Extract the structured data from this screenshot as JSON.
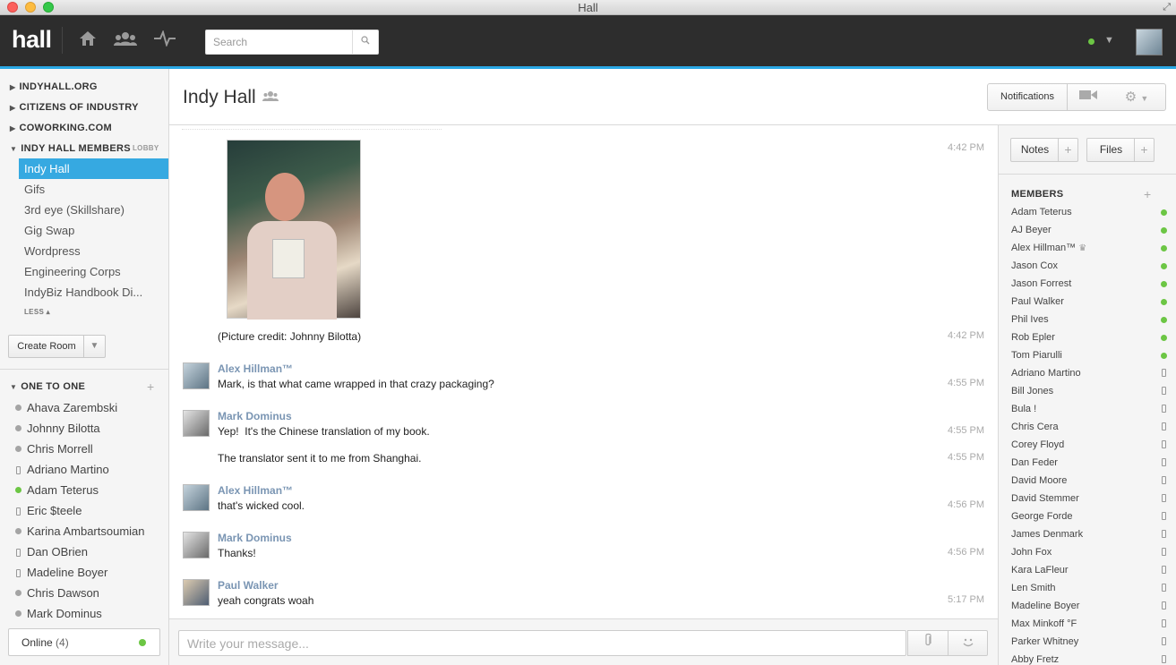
{
  "window": {
    "title": "Hall"
  },
  "topbar": {
    "logo": "hall",
    "search_placeholder": "Search",
    "icons": [
      "home-icon",
      "people-icon",
      "activity-icon",
      "search-icon"
    ]
  },
  "sidebar": {
    "groups": [
      {
        "label": "INDYHALL.ORG"
      },
      {
        "label": "CITIZENS OF INDUSTRY"
      },
      {
        "label": "COWORKING.COM"
      },
      {
        "label": "INDY HALL MEMBERS",
        "tag": "LOBBY"
      }
    ],
    "rooms": [
      {
        "label": "Indy Hall"
      },
      {
        "label": "Gifs"
      },
      {
        "label": "3rd eye (Skillshare)"
      },
      {
        "label": "Gig Swap"
      },
      {
        "label": "Wordpress"
      },
      {
        "label": "Engineering Corps"
      },
      {
        "label": "IndyBiz Handbook Di..."
      }
    ],
    "less_label": "LESS",
    "create_room_label": "Create Room",
    "one_to_one_label": "ONE TO ONE",
    "people": [
      {
        "name": "Ahava Zarembski",
        "status": "offline"
      },
      {
        "name": "Johnny Bilotta",
        "status": "offline"
      },
      {
        "name": "Chris Morrell",
        "status": "offline"
      },
      {
        "name": "Adriano Martino",
        "status": "mobile"
      },
      {
        "name": "Adam Teterus",
        "status": "online"
      },
      {
        "name": "Eric $teele",
        "status": "mobile"
      },
      {
        "name": "Karina Ambartsoumian",
        "status": "offline"
      },
      {
        "name": "Dan OBrien",
        "status": "mobile"
      },
      {
        "name": "Madeline Boyer",
        "status": "mobile"
      },
      {
        "name": "Chris Dawson",
        "status": "offline"
      },
      {
        "name": "Mark Dominus",
        "status": "offline"
      }
    ],
    "online_label": "Online",
    "online_count": "(4)"
  },
  "header": {
    "room_title": "Indy Hall",
    "notifications_label": "Notifications"
  },
  "messages": [
    {
      "text": "",
      "time": "4:42 PM"
    },
    {
      "text": "(Picture credit: Johnny Bilotta)",
      "time": "4:42 PM"
    },
    {
      "author": "Alex Hillman™",
      "text": "Mark, is that what came wrapped in that crazy packaging?",
      "time": "4:55 PM"
    },
    {
      "author": "Mark Dominus",
      "text": "Yep!  It's the Chinese translation of my book.",
      "time": "4:55 PM"
    },
    {
      "text": "The translator sent it to me from Shanghai.",
      "time": "4:55 PM"
    },
    {
      "author": "Alex Hillman™",
      "text": "that's wicked cool.",
      "time": "4:56 PM"
    },
    {
      "author": "Mark Dominus",
      "text": "Thanks!",
      "time": "4:56 PM"
    },
    {
      "author": "Paul Walker",
      "text": "yeah congrats woah",
      "time": "5:17 PM"
    }
  ],
  "composer": {
    "placeholder": "Write your message..."
  },
  "right_panel": {
    "notes_label": "Notes",
    "files_label": "Files",
    "members_label": "MEMBERS",
    "members": [
      {
        "name": "Adam Teterus",
        "status": "online"
      },
      {
        "name": "AJ Beyer",
        "status": "online"
      },
      {
        "name": "Alex Hillman™",
        "status": "online",
        "crown": "♛"
      },
      {
        "name": "Jason Cox",
        "status": "online"
      },
      {
        "name": "Jason Forrest",
        "status": "online"
      },
      {
        "name": "Paul Walker",
        "status": "online"
      },
      {
        "name": "Phil Ives",
        "status": "online"
      },
      {
        "name": "Rob Epler",
        "status": "online"
      },
      {
        "name": "Tom Piarulli",
        "status": "online"
      },
      {
        "name": "Adriano Martino",
        "status": "mobile"
      },
      {
        "name": "Bill Jones",
        "status": "mobile"
      },
      {
        "name": "Bula !",
        "status": "mobile"
      },
      {
        "name": "Chris Cera",
        "status": "mobile"
      },
      {
        "name": "Corey Floyd",
        "status": "mobile"
      },
      {
        "name": "Dan Feder",
        "status": "mobile"
      },
      {
        "name": "David Moore",
        "status": "mobile"
      },
      {
        "name": "David Stemmer",
        "status": "mobile"
      },
      {
        "name": "George Forde",
        "status": "mobile"
      },
      {
        "name": "James Denmark",
        "status": "mobile"
      },
      {
        "name": "John Fox",
        "status": "mobile"
      },
      {
        "name": "Kara LaFleur",
        "status": "mobile"
      },
      {
        "name": "Len Smith",
        "status": "mobile"
      },
      {
        "name": "Madeline Boyer",
        "status": "mobile"
      },
      {
        "name": "Max Minkoff °F",
        "status": "mobile"
      },
      {
        "name": "Parker Whitney",
        "status": "mobile"
      },
      {
        "name": "Abby Fretz",
        "status": "mobile"
      }
    ]
  },
  "colors": {
    "accent": "#2aa7e4",
    "online": "#6cc644",
    "topbar": "#2d2d2d",
    "author": "#7a95b3"
  }
}
